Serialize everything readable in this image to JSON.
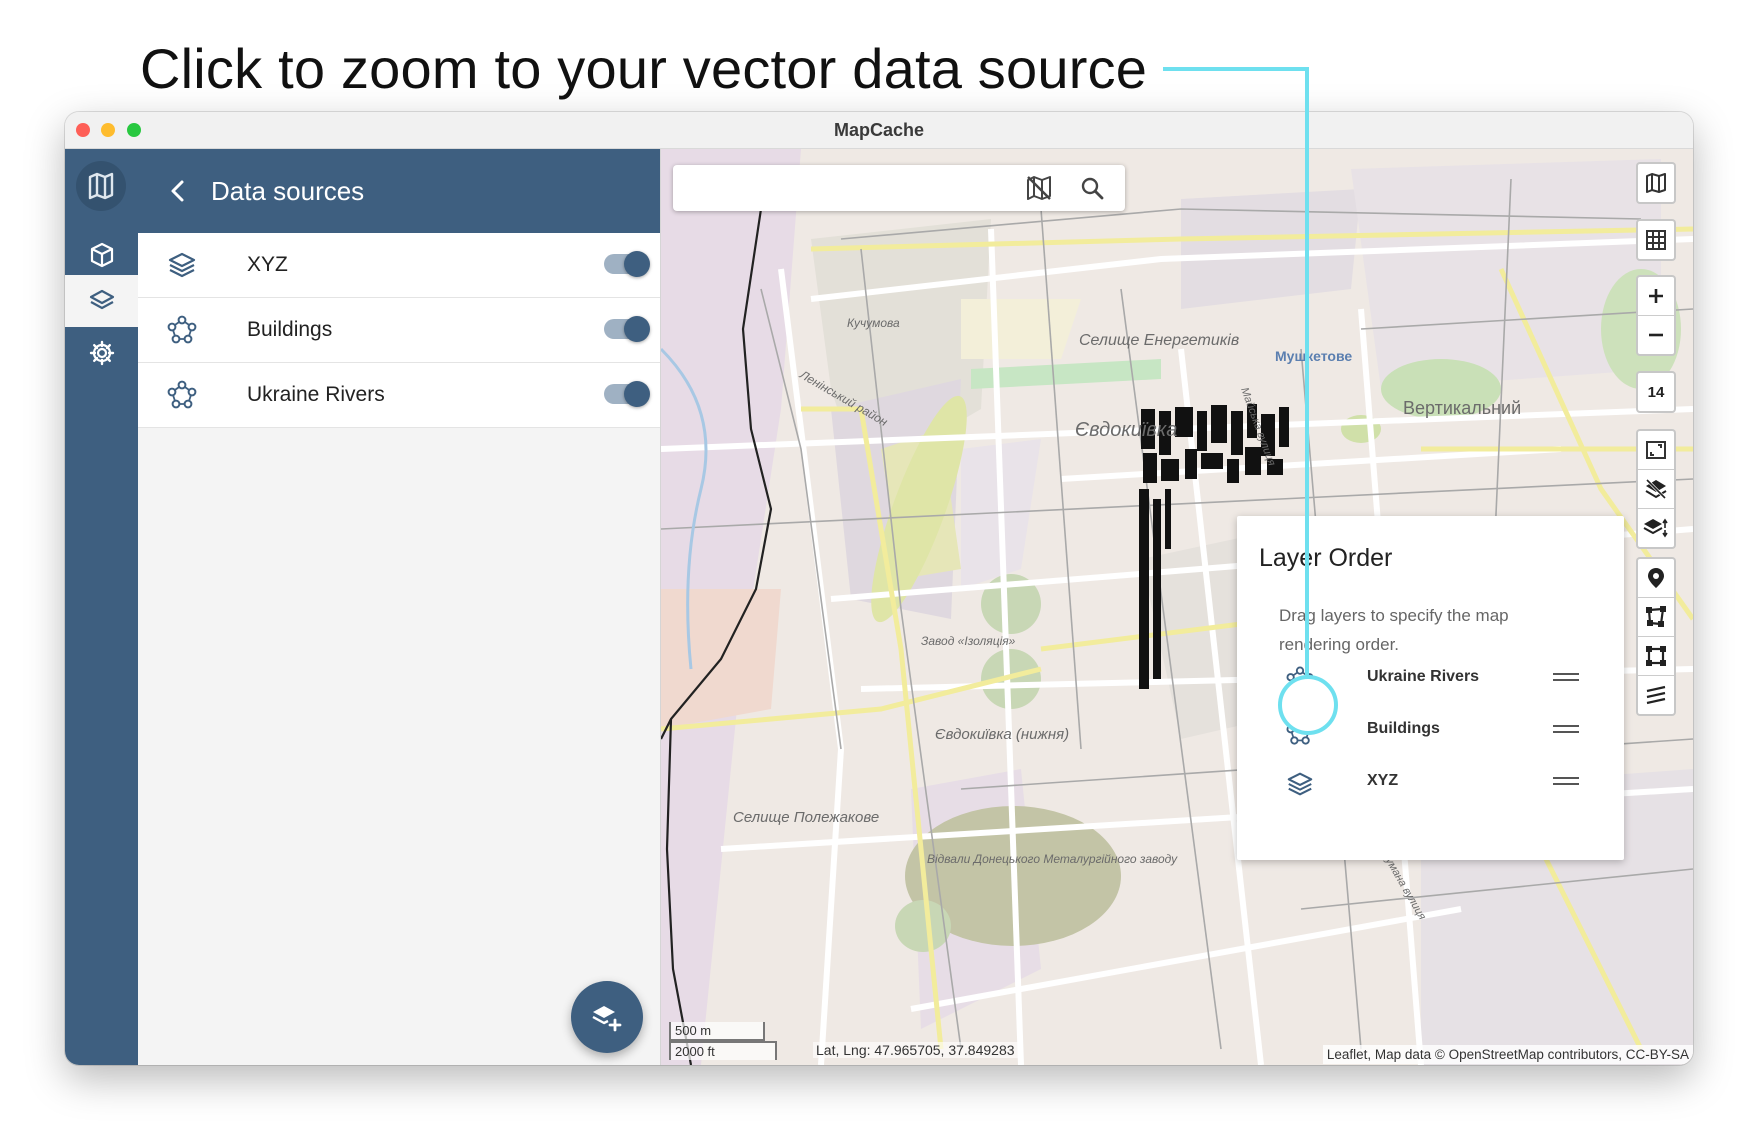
{
  "headline": "Click to zoom to your vector data source",
  "window": {
    "title": "MapCache"
  },
  "panel": {
    "title": "Data sources",
    "sources": [
      {
        "name": "XYZ",
        "icon": "layers-icon",
        "enabled": true
      },
      {
        "name": "Buildings",
        "icon": "vector-polygon-icon",
        "enabled": true
      },
      {
        "name": "Ukraine Rivers",
        "icon": "vector-polygon-icon",
        "enabled": true
      }
    ]
  },
  "map": {
    "zoom_level": "14",
    "labels": [
      "Кучумова",
      "Селище Енергетиків",
      "Мушкетове",
      "Вертикальний",
      "Євдокиївка",
      "Ленінський район",
      "Завод «Ізоляція»",
      "Євдокиївка (нижня)",
      "Селище Полежакове",
      "Відвали Донецького Металургійного заводу",
      "Майська вулиця",
      "Баумана вулиця"
    ],
    "scale_metric": "500 m",
    "scale_imperial": "2000 ft",
    "latlng": "Lat, Lng: 47.965705, 37.849283",
    "attribution": "Leaflet, Map data © OpenStreetMap contributors, CC-BY-SA"
  },
  "layer_order": {
    "title": "Layer Order",
    "description": "Drag layers to specify the map rendering order.",
    "layers": [
      {
        "name": "Ukraine Rivers",
        "icon": "vector-polygon-icon"
      },
      {
        "name": "Buildings",
        "icon": "vector-polygon-icon"
      },
      {
        "name": "XYZ",
        "icon": "layers-icon"
      }
    ]
  },
  "colors": {
    "sidebar": "#3e5f80",
    "callout": "#6ee0ef",
    "map_base": "#efe9e4"
  }
}
